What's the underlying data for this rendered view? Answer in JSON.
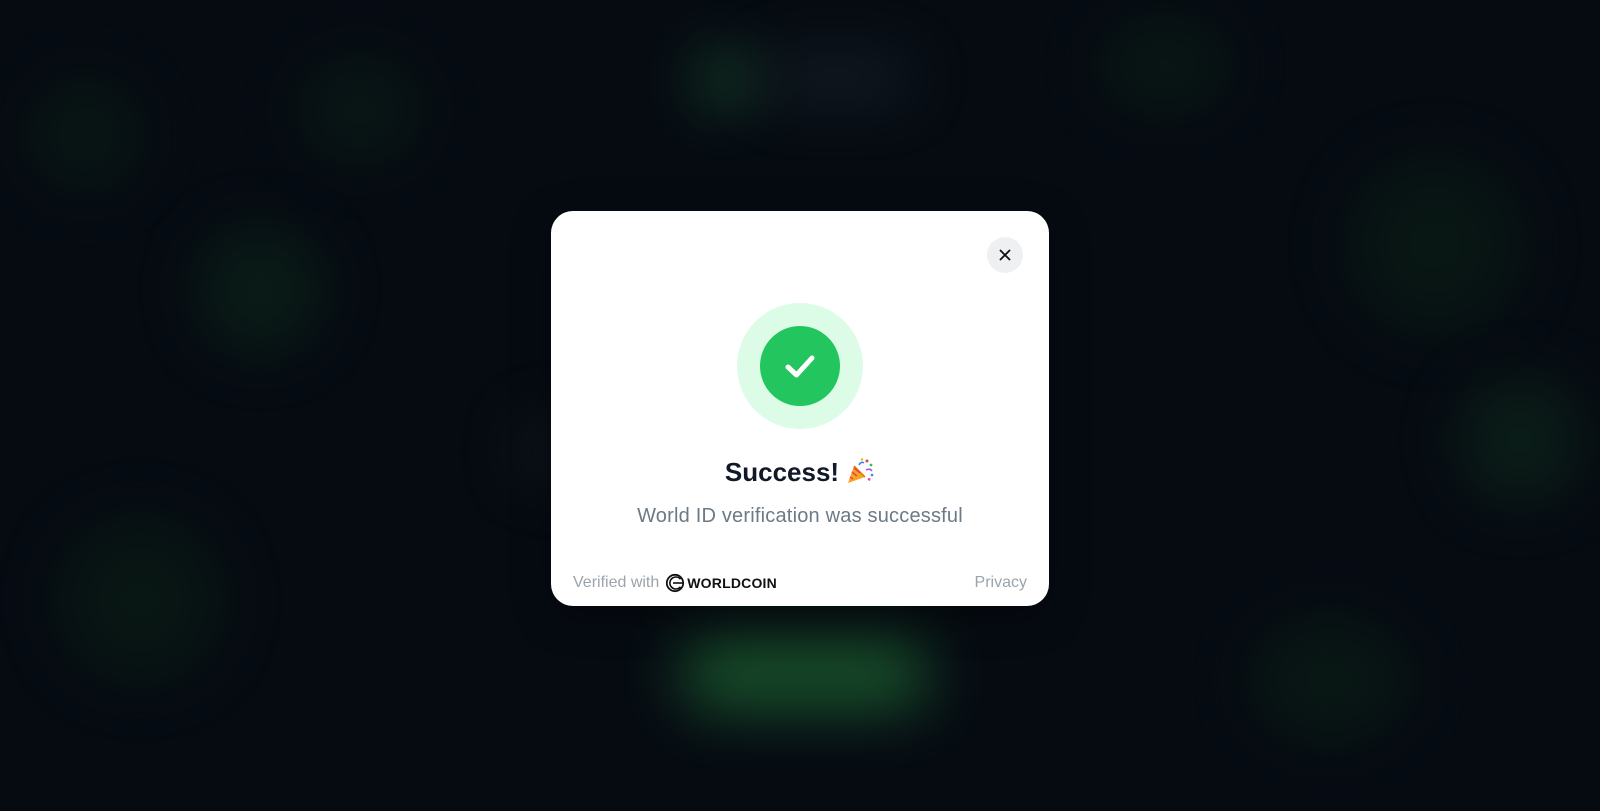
{
  "colors": {
    "backdrop": "#060b12",
    "accent_green": "#22c55e",
    "accent_green_light": "#dcfce7",
    "title_text": "#111827",
    "muted_text": "#9aa4ad"
  },
  "modal": {
    "close_icon": "close-icon",
    "status_icon": "check-icon",
    "title": "Success!",
    "title_emoji_icon": "party-popper-icon",
    "subtitle": "World ID verification was successful",
    "footer": {
      "verified_label": "Verified with",
      "brand_icon": "worldcoin-logo-icon",
      "brand_name": "WORLDCOIN",
      "privacy_label": "Privacy"
    }
  }
}
